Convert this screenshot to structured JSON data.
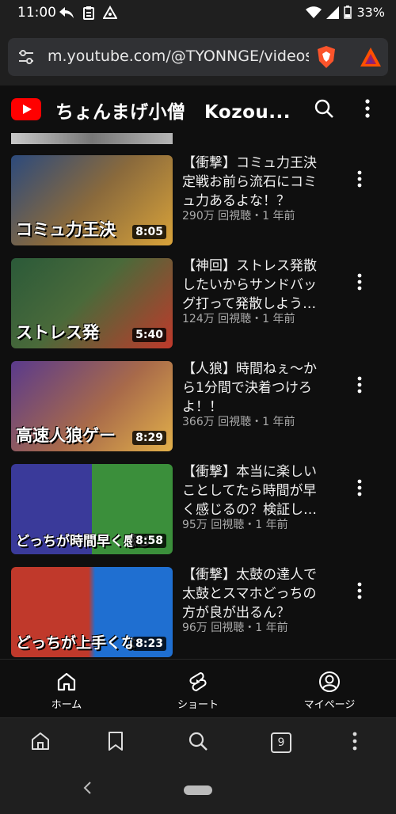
{
  "status": {
    "time": "11:00",
    "battery": "33%"
  },
  "browser": {
    "url": "m.youtube.com/@TYONNGE/videos",
    "tab_count": "9"
  },
  "header": {
    "channel_name": "ちょんまげ小僧　Kozou..."
  },
  "videos": [
    {
      "title": "【衝撃】コミュ力王決定戦お前ら流石にコミュ力あるよな！？",
      "meta": "290万 回視聴・1 年前",
      "duration": "8:05",
      "thumb_caption": "コミュ力王決",
      "thumb_colors": [
        "#2c4a7c",
        "#d9a33a"
      ]
    },
    {
      "title": "【神回】ストレス発散したいからサンドバッグ打って発散しよう…",
      "meta": "124万 回視聴・1 年前",
      "duration": "5:40",
      "thumb_caption": "ストレス発",
      "thumb_colors": [
        "#2b5a39",
        "#c0392b"
      ]
    },
    {
      "title": "【人狼】時間ねぇ〜から1分間で決着つけろよ！！",
      "meta": "366万 回視聴・1 年前",
      "duration": "8:29",
      "thumb_caption": "高速人狼ゲー",
      "thumb_colors": [
        "#5a3a8c",
        "#e2b04a"
      ]
    },
    {
      "title": "【衝撃】本当に楽しいことしてたら時間が早く感じるの？検証し…",
      "meta": "95万 回視聴・1 年前",
      "duration": "8:58",
      "thumb_caption": "どっちが時間早く感じ",
      "thumb_colors": [
        "#3a3a9a",
        "#3b8f3b"
      ]
    },
    {
      "title": "【衝撃】太鼓の達人で太鼓とスマホどっちの方が良が出るん？",
      "meta": "96万 回視聴・1 年前",
      "duration": "8:23",
      "thumb_caption": "どっちが上手くな",
      "thumb_colors": [
        "#c0392b",
        "#1f6fd1"
      ]
    }
  ],
  "nav": {
    "home": "ホーム",
    "shorts": "ショート",
    "mypage": "マイページ"
  },
  "colors": {
    "yt_red": "#ff0000",
    "brave_orange": "#fb542b"
  }
}
